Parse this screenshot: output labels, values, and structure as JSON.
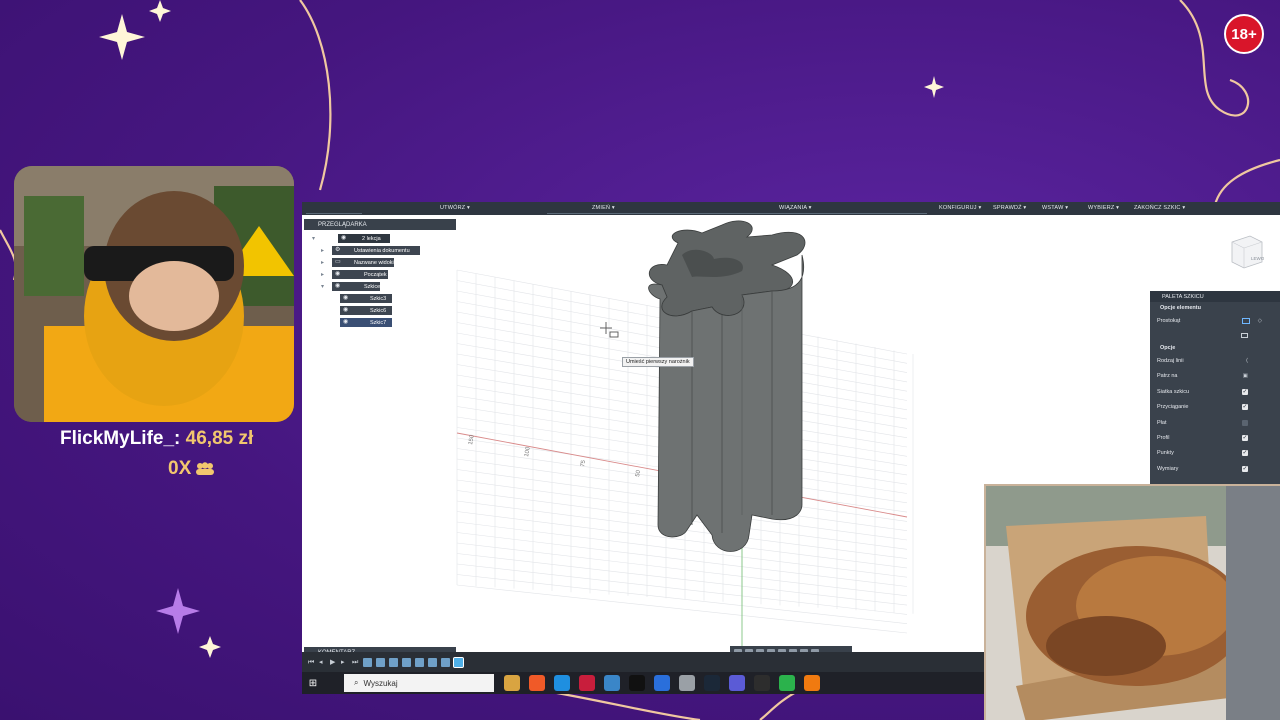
{
  "stream": {
    "age_badge": "18+",
    "donor_name": "FlickMyLife_:",
    "donor_amount": "46,85 zł",
    "multiplier": "0X",
    "multiplier_icon": "people-icon"
  },
  "fusion": {
    "toolbar": {
      "items": [
        "UTWÓRZ ▾",
        "ZMIEŃ ▾",
        "WIĄZANIA ▾",
        "KONFIGURUJ ▾",
        "SPRAWDŹ ▾",
        "WSTAW ▾",
        "WYBIERZ ▾",
        "ZAKOŃCZ SZKIC ▾"
      ]
    },
    "browser": {
      "title": "PRZEGLĄDARKA",
      "root": "2 lekcja",
      "items": [
        "Ustawienia dokumentu",
        "Nazwane widoki",
        "Początek",
        "Szkice"
      ],
      "sketches": [
        "Szkic3",
        "Szkic6",
        "Szkic7"
      ]
    },
    "tooltip": "Umieść pierwszy narożnik",
    "palette": {
      "title": "PALETA SZKICU",
      "element_options": "Opcje elementu",
      "rectangle_label": "Prostokąt",
      "options_title": "Opcje",
      "rows": [
        {
          "label": "Rodzaj linii",
          "checked": null
        },
        {
          "label": "Patrz na",
          "checked": null
        },
        {
          "label": "Siatka szkicu",
          "checked": true
        },
        {
          "label": "Przyciąganie",
          "checked": true
        },
        {
          "label": "Płat",
          "checked": false
        },
        {
          "label": "Profil",
          "checked": true
        },
        {
          "label": "Punkty",
          "checked": true
        },
        {
          "label": "Wymiary",
          "checked": true
        }
      ]
    },
    "comment_bar": "KOMENTARZ",
    "viewcube_label": "LEWO",
    "axis_ticks": [
      "150",
      "100",
      "75",
      "50"
    ]
  },
  "taskbar": {
    "search_placeholder": "Wyszukaj",
    "colors": [
      "#d9a441",
      "#f05a28",
      "#1f8fe0",
      "#c81e3c",
      "#3a86c8",
      "#111111",
      "#2a6fdb",
      "#9aa0a6",
      "#1b2838",
      "#5b5bd6",
      "#2d2d2d",
      "#2bb24c",
      "#f07a10"
    ]
  }
}
